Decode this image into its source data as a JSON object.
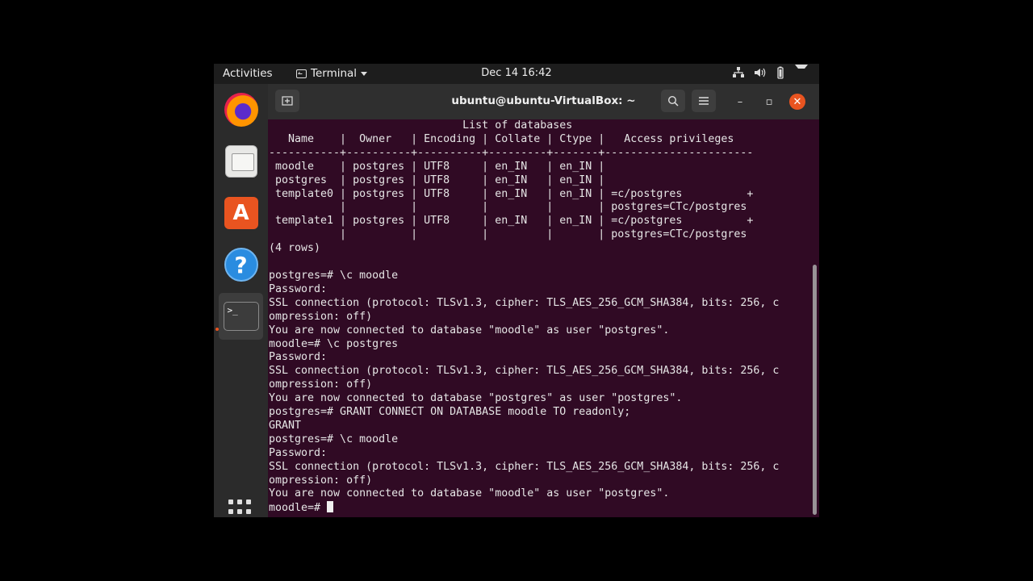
{
  "topbar": {
    "activities": "Activities",
    "app_name": "Terminal",
    "clock": "Dec 14  16:42",
    "tray_icons": [
      "network-icon",
      "volume-icon",
      "battery-icon",
      "system-menu-caret-icon"
    ]
  },
  "dock": {
    "items": [
      {
        "name": "firefox-icon",
        "label": "Firefox"
      },
      {
        "name": "files-icon",
        "label": "Files"
      },
      {
        "name": "software-icon",
        "label": "Ubuntu Software"
      },
      {
        "name": "help-icon",
        "label": "Help"
      },
      {
        "name": "terminal-icon",
        "label": "Terminal"
      }
    ],
    "terminal_glyph": ">_",
    "help_glyph": "?",
    "store_glyph": "A"
  },
  "window": {
    "title": "ubuntu@ubuntu-VirtualBox: ~",
    "buttons": {
      "minimize": "–",
      "maximize": "▫",
      "close": "✕"
    }
  },
  "terminal": {
    "lines": [
      "                              List of databases",
      "   Name    |  Owner   | Encoding | Collate | Ctype |   Access privileges",
      "-----------+----------+----------+---------+-------+-----------------------",
      " moodle    | postgres | UTF8     | en_IN   | en_IN |",
      " postgres  | postgres | UTF8     | en_IN   | en_IN |",
      " template0 | postgres | UTF8     | en_IN   | en_IN | =c/postgres          +",
      "           |          |          |         |       | postgres=CTc/postgres",
      " template1 | postgres | UTF8     | en_IN   | en_IN | =c/postgres          +",
      "           |          |          |         |       | postgres=CTc/postgres",
      "(4 rows)",
      "",
      "postgres=# \\c moodle",
      "Password:",
      "SSL connection (protocol: TLSv1.3, cipher: TLS_AES_256_GCM_SHA384, bits: 256, c",
      "ompression: off)",
      "You are now connected to database \"moodle\" as user \"postgres\".",
      "moodle=# \\c postgres",
      "Password:",
      "SSL connection (protocol: TLSv1.3, cipher: TLS_AES_256_GCM_SHA384, bits: 256, c",
      "ompression: off)",
      "You are now connected to database \"postgres\" as user \"postgres\".",
      "postgres=# GRANT CONNECT ON DATABASE moodle TO readonly;",
      "GRANT",
      "postgres=# \\c moodle",
      "Password:",
      "SSL connection (protocol: TLSv1.3, cipher: TLS_AES_256_GCM_SHA384, bits: 256, c",
      "ompression: off)",
      "You are now connected to database \"moodle\" as user \"postgres\"."
    ],
    "prompt": "moodle=# "
  }
}
